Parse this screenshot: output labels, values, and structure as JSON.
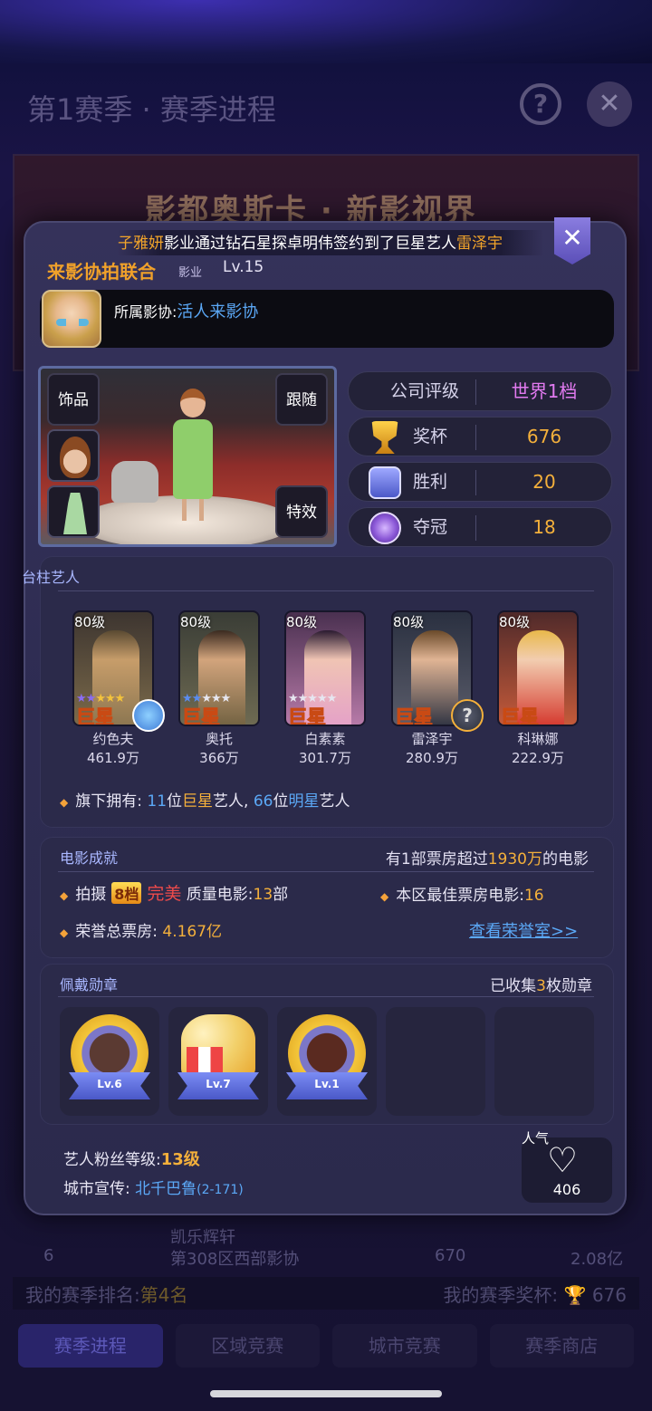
{
  "background": {
    "title": "第1赛季 · 赛季进程",
    "help_icon": "?",
    "close_icon": "✕",
    "banner_text": "影都奥斯卡 · 新影视界",
    "row": {
      "rank": "6",
      "name": "凯乐辉轩",
      "sub": "第308区西部影协",
      "score": "670",
      "value": "2.08亿"
    },
    "my_rank_label": "我的赛季排名:",
    "my_rank_value": "第4名",
    "my_reward_label": "我的赛季奖杯:",
    "my_reward_value": "676",
    "tabs": [
      "赛季进程",
      "区域竞赛",
      "城市竞赛",
      "赛季商店"
    ]
  },
  "marquee": {
    "name1": "子雅妍",
    "mid": "影业通过钻石星探卓明伟签约到了巨星艺人",
    "name2": "雷泽宇"
  },
  "modal_close": "✕",
  "profile": {
    "guild_name": "来影协拍联合",
    "guild_tag": "影业",
    "level": "Lv.15",
    "affiliation_label": "所属影协:",
    "affiliation_value": "活人来影协"
  },
  "stage": {
    "btn_accessory": "饰品",
    "btn_follow": "跟随",
    "btn_effects": "特效"
  },
  "stats": [
    {
      "label": "公司评级",
      "value": "世界1档",
      "icon": ""
    },
    {
      "label": "奖杯",
      "value": "676",
      "icon": "trophy-icon"
    },
    {
      "label": "胜利",
      "value": "20",
      "icon": "victory-icon"
    },
    {
      "label": "夺冠",
      "value": "18",
      "icon": "crown-icon"
    }
  ],
  "artists_section": {
    "title": "台柱艺人",
    "artists": [
      {
        "level": "80级",
        "tier": "巨星",
        "name": "约色夫",
        "value": "461.9万"
      },
      {
        "level": "80级",
        "tier": "巨星",
        "name": "奥托",
        "value": "366万"
      },
      {
        "level": "80级",
        "tier": "巨星",
        "name": "白素素",
        "value": "301.7万"
      },
      {
        "level": "80级",
        "tier": "巨星",
        "name": "雷泽宇",
        "value": "280.9万"
      },
      {
        "level": "80级",
        "tier": "巨星",
        "name": "科琳娜",
        "value": "222.9万"
      }
    ],
    "own_prefix": "旗下拥有:",
    "own_count1": "11",
    "own_mid1": "位",
    "own_tier1": "巨星",
    "own_mid2": "艺人,",
    "own_count2": "66",
    "own_mid3": "位",
    "own_tier2": "明星",
    "own_suffix": "艺人"
  },
  "movie_section": {
    "title": "电影成就",
    "right_prefix": "有1部票房超过",
    "right_num": "1930万",
    "right_suffix": "的电影",
    "shoot_label": "拍摄",
    "shoot_tier": "8档",
    "shoot_quality": "完美",
    "shoot_mid": "质量电影:",
    "shoot_count": "13",
    "shoot_unit": "部",
    "best_label": "本区最佳票房电影:",
    "best_value": "16",
    "honor_label": "荣誉总票房:",
    "honor_value": "4.167亿",
    "honor_link": "查看荣誉室>>"
  },
  "medal_section": {
    "title": "佩戴勋章",
    "right_prefix": "已收集",
    "right_num": "3",
    "right_suffix": "枚勋章",
    "medals": [
      "Lv.6",
      "Lv.7",
      "Lv.1"
    ]
  },
  "footer": {
    "fan_label": "艺人粉丝等级:",
    "fan_value": "13级",
    "city_label": "城市宣传:",
    "city_value": "北千巴鲁",
    "city_range": "(2-171)",
    "popularity_label": "人气",
    "popularity_value": "406"
  }
}
